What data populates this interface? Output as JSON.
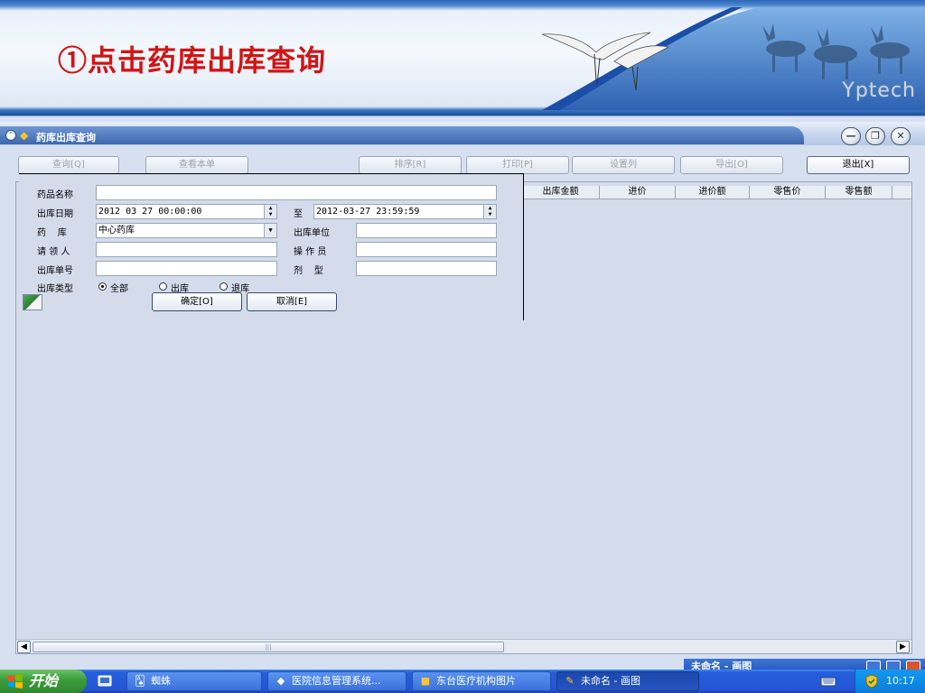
{
  "banner": {
    "tutorial_text": "①点击药库出库查询",
    "brand": "Yptech"
  },
  "window": {
    "title": "药库出库查询",
    "controls": {
      "minimize": "—",
      "restore": "❐",
      "close": "✕"
    }
  },
  "toolbar": {
    "query": "查询[Q]",
    "view_doc": "查看本单",
    "sort": "排序[R]",
    "print": "打印[P]",
    "set_columns": "设置列",
    "export": "导出[O]",
    "exit": "退出[X]"
  },
  "grid": {
    "columns": [
      "出库金额",
      "进价",
      "进价额",
      "零售价",
      "零售额"
    ]
  },
  "form": {
    "drug_name_label": "药品名称",
    "drug_name_value": "",
    "out_date_label": "出库日期",
    "out_date_from": "2012 03 27 00:00:00",
    "to_label": "至",
    "out_date_to": "2012-03-27 23:59:59",
    "warehouse_label": "药    库",
    "warehouse_value": "中心药库",
    "out_unit_label": "出库单位",
    "out_unit_value": "",
    "requester_label": "请 领 人",
    "requester_value": "",
    "operator_label": "操 作 员",
    "operator_value": "",
    "doc_no_label": "出库单号",
    "doc_no_value": "",
    "dosage_label": "剂    型",
    "dosage_value": "",
    "type_label": "出库类型",
    "type_options": [
      "全部",
      "出库",
      "退库"
    ],
    "type_selected": "全部",
    "ok_button": "确定[O]",
    "cancel_button": "取消[E]"
  },
  "behind_window": {
    "title": "未命名 - 画图"
  },
  "taskbar": {
    "start_label": "开始",
    "tasks": [
      {
        "label": "蜘蛛",
        "active": false
      },
      {
        "label": "医院信息管理系统...",
        "active": false
      },
      {
        "label": "东台医疗机构图片",
        "active": false
      },
      {
        "label": "未命名 - 画图",
        "active": true
      }
    ],
    "clock": "10:17"
  },
  "colors": {
    "tutorial_text": "#d21414",
    "title_bar": "#3c67b0",
    "taskbar": "#2454d4",
    "start_button": "#3c9a3a",
    "tray": "#0d8ce8"
  }
}
